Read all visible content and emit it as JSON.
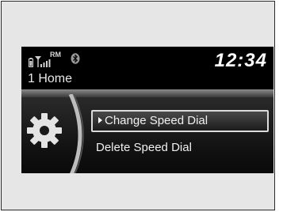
{
  "status_bar": {
    "battery_icon": "battery-icon",
    "signal_icon": "signal-strength-icon",
    "roaming_label": "RM",
    "bluetooth_icon": "bluetooth-icon",
    "clock": "12:34"
  },
  "header": {
    "title": "1 Home"
  },
  "menu": {
    "icon": "gear-icon",
    "items": [
      {
        "label": "Change Speed Dial",
        "selected": true
      },
      {
        "label": "Delete Speed Dial",
        "selected": false
      }
    ]
  },
  "colors": {
    "screen_background": "#000000",
    "text": "#f0f0f0",
    "selection_border": "#dcdcdc"
  }
}
